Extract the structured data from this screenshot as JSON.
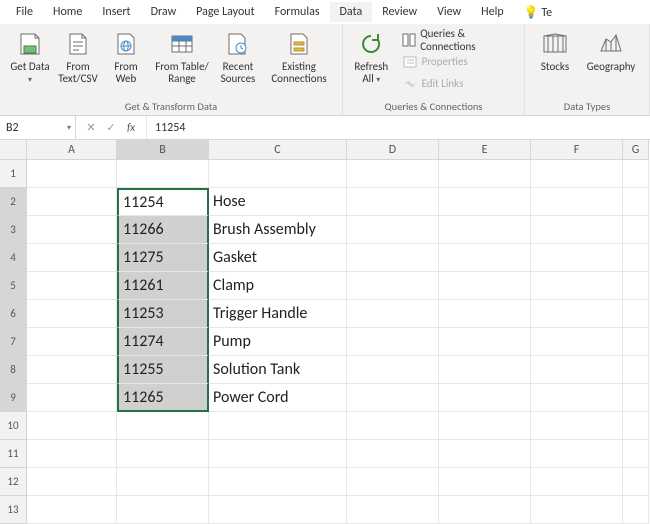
{
  "tabs": {
    "file": "File",
    "home": "Home",
    "insert": "Insert",
    "draw": "Draw",
    "page_layout": "Page Layout",
    "formulas": "Formulas",
    "data": "Data",
    "review": "Review",
    "view": "View",
    "help": "Help",
    "tell": "Te"
  },
  "active_tab": "Data",
  "ribbon": {
    "get_transform": {
      "get_data": "Get Data",
      "from_text_csv": "From Text/CSV",
      "from_web": "From Web",
      "from_table_range": "From Table/ Range",
      "recent_sources": "Recent Sources",
      "existing_connections": "Existing Connections",
      "label": "Get & Transform Data"
    },
    "queries": {
      "refresh_all": "Refresh All",
      "queries_connections": "Queries & Connections",
      "properties": "Properties",
      "edit_links": "Edit Links",
      "label": "Queries & Connections"
    },
    "data_types": {
      "stocks": "Stocks",
      "geography": "Geography",
      "label": "Data Types"
    }
  },
  "name_box": "B2",
  "formula_value": "11254",
  "columns": [
    "A",
    "B",
    "C",
    "D",
    "E",
    "F",
    "G"
  ],
  "rows": [
    1,
    2,
    3,
    4,
    5,
    6,
    7,
    8,
    9,
    10,
    11,
    12,
    13
  ],
  "cells": {
    "B2": "11254",
    "C2": "Hose",
    "B3": "11266",
    "C3": "Brush Assembly",
    "B4": "11275",
    "C4": "Gasket",
    "B5": "11261",
    "C5": "Clamp",
    "B6": "11253",
    "C6": "Trigger Handle",
    "B7": "11274",
    "C7": "Pump",
    "B8": "11255",
    "C8": "Solution Tank",
    "B9": "11265",
    "C9": "Power Cord"
  },
  "selection": {
    "range": "B2:B9",
    "active": "B2"
  }
}
